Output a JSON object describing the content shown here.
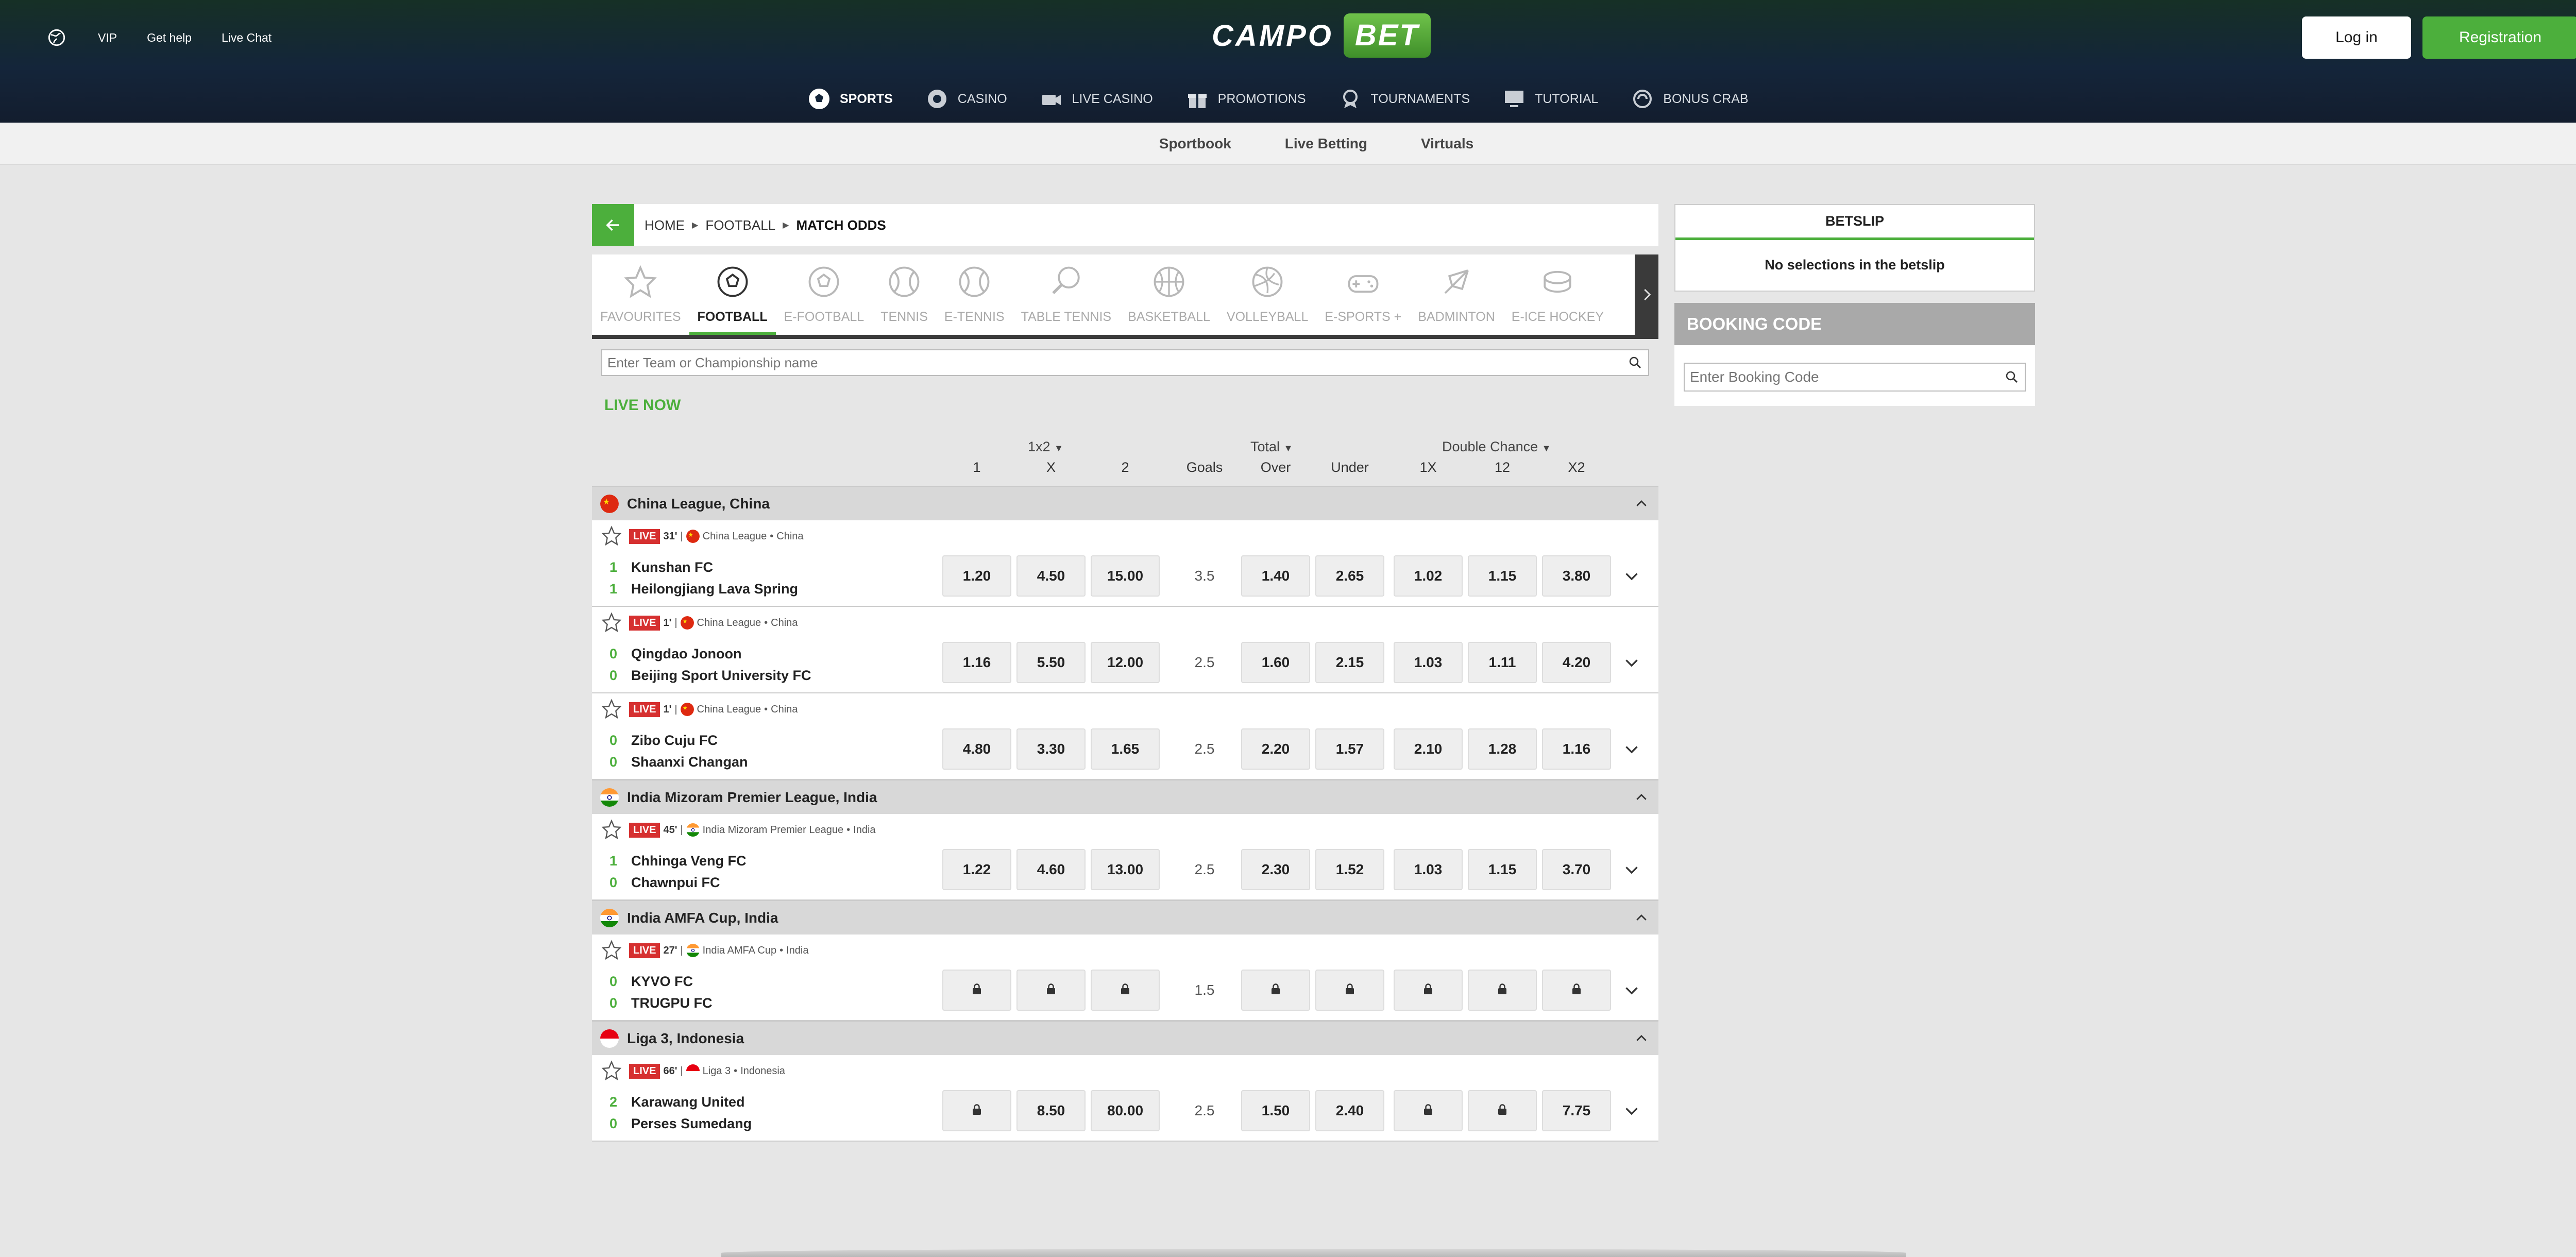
{
  "toplinks": {
    "vip": "VIP",
    "help": "Get help",
    "chat": "Live Chat"
  },
  "logo": {
    "campo": "CAMPO",
    "bet": "BET"
  },
  "auth": {
    "login": "Log in",
    "register": "Registration"
  },
  "mainnav": [
    {
      "label": "SPORTS",
      "icon": "soccer-ball-icon",
      "active": true
    },
    {
      "label": "CASINO",
      "icon": "poker-chip-icon"
    },
    {
      "label": "LIVE CASINO",
      "icon": "camera-icon"
    },
    {
      "label": "PROMOTIONS",
      "icon": "gift-icon"
    },
    {
      "label": "TOURNAMENTS",
      "icon": "medal-icon"
    },
    {
      "label": "TUTORIAL",
      "icon": "monitor-icon"
    },
    {
      "label": "BONUS CRAB",
      "icon": "crab-icon"
    }
  ],
  "subnav": [
    "Sportbook",
    "Live Betting",
    "Virtuals"
  ],
  "breadcrumb": {
    "home": "HOME",
    "football": "FOOTBALL",
    "current": "MATCH ODDS"
  },
  "sports": [
    "FAVOURITES",
    "FOOTBALL",
    "E-FOOTBALL",
    "TENNIS",
    "E-TENNIS",
    "TABLE TENNIS",
    "BASKETBALL",
    "VOLLEYBALL",
    "E-SPORTS +",
    "BADMINTON",
    "E-ICE HOCKEY"
  ],
  "search": {
    "placeholder": "Enter Team or Championship name"
  },
  "live_now": "LIVE NOW",
  "markets": {
    "m1": "1x2",
    "m2": "Total",
    "m3": "Double Chance"
  },
  "columns": [
    "1",
    "X",
    "2",
    "Goals",
    "Over",
    "Under",
    "1X",
    "12",
    "X2"
  ],
  "live_label": "LIVE",
  "leagues": [
    {
      "name": "China League, China",
      "flag": "china",
      "matches": [
        {
          "minute": "31'",
          "league": "China League",
          "country": "China",
          "home": "Kunshan FC",
          "away": "Heilongjiang Lava Spring",
          "hs": "1",
          "as": "1",
          "odds": [
            "1.20",
            "4.50",
            "15.00"
          ],
          "goals": "3.5",
          "ou": [
            "1.40",
            "2.65"
          ],
          "dc": [
            "1.02",
            "1.15",
            "3.80"
          ]
        },
        {
          "minute": "1'",
          "league": "China League",
          "country": "China",
          "home": "Qingdao Jonoon",
          "away": "Beijing Sport University FC",
          "hs": "0",
          "as": "0",
          "odds": [
            "1.16",
            "5.50",
            "12.00"
          ],
          "goals": "2.5",
          "ou": [
            "1.60",
            "2.15"
          ],
          "dc": [
            "1.03",
            "1.11",
            "4.20"
          ]
        },
        {
          "minute": "1'",
          "league": "China League",
          "country": "China",
          "home": "Zibo Cuju FC",
          "away": "Shaanxi Changan",
          "hs": "0",
          "as": "0",
          "odds": [
            "4.80",
            "3.30",
            "1.65"
          ],
          "goals": "2.5",
          "ou": [
            "2.20",
            "1.57"
          ],
          "dc": [
            "2.10",
            "1.28",
            "1.16"
          ]
        }
      ]
    },
    {
      "name": "India Mizoram Premier League, India",
      "flag": "india",
      "matches": [
        {
          "minute": "45'",
          "league": "India Mizoram Premier League",
          "country": "India",
          "home": "Chhinga Veng FC",
          "away": "Chawnpui FC",
          "hs": "1",
          "as": "0",
          "odds": [
            "1.22",
            "4.60",
            "13.00"
          ],
          "goals": "2.5",
          "ou": [
            "2.30",
            "1.52"
          ],
          "dc": [
            "1.03",
            "1.15",
            "3.70"
          ]
        }
      ]
    },
    {
      "name": "India AMFA Cup, India",
      "flag": "india",
      "matches": [
        {
          "minute": "27'",
          "league": "India AMFA Cup",
          "country": "India",
          "home": "KYVO FC",
          "away": "TRUGPU FC",
          "hs": "0",
          "as": "0",
          "odds": [
            "",
            "",
            ""
          ],
          "goals": "1.5",
          "ou": [
            "",
            ""
          ],
          "dc": [
            "",
            "",
            ""
          ]
        }
      ]
    },
    {
      "name": "Liga 3, Indonesia",
      "flag": "indonesia",
      "matches": [
        {
          "minute": "66'",
          "league": "Liga 3",
          "country": "Indonesia",
          "home": "Karawang United",
          "away": "Perses Sumedang",
          "hs": "2",
          "as": "0",
          "odds": [
            "",
            "8.50",
            "80.00"
          ],
          "goals": "2.5",
          "ou": [
            "1.50",
            "2.40"
          ],
          "dc": [
            "",
            "",
            "7.75"
          ]
        }
      ]
    }
  ],
  "betslip": {
    "title": "BETSLIP",
    "empty": "No selections in the betslip"
  },
  "booking": {
    "title": "BOOKING CODE",
    "placeholder": "Enter Booking Code"
  },
  "colors": {
    "accent": "#4caf3c",
    "live": "#d63030",
    "header": "#14253a"
  }
}
